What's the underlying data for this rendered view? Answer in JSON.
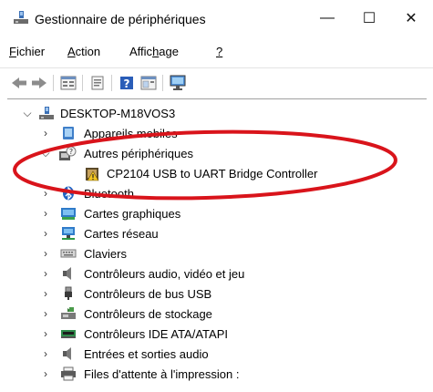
{
  "window": {
    "title": "Gestionnaire de périphériques",
    "minimize_symbol": "—",
    "maximize_symbol": "☐",
    "close_symbol": "✕"
  },
  "menu": [
    {
      "label": "Fichier",
      "access_key_index": 0
    },
    {
      "label": "Action",
      "access_key_index": 0
    },
    {
      "label": "Affichage",
      "access_key_index": 5
    },
    {
      "label": "?",
      "access_key_index": 0
    }
  ],
  "toolbar": {
    "buttons": [
      "back-icon",
      "forward-icon",
      "properties-icon",
      "view-icon",
      "help-icon",
      "update-icon",
      "monitor-icon"
    ]
  },
  "tree": {
    "root": {
      "label": "DESKTOP-M18VOS3",
      "icon": "computer-icon",
      "expanded": true
    },
    "items": [
      {
        "label": "Appareils mobiles",
        "icon": "mobile-device-icon",
        "expanded": false,
        "level": 1
      },
      {
        "label": "Autres périphériques",
        "icon": "unknown-device-icon",
        "expanded": true,
        "level": 1
      },
      {
        "label": "CP2104 USB to UART Bridge Controller",
        "icon": "warning-device-icon",
        "expanded": null,
        "level": 2
      },
      {
        "label": "Bluetooth",
        "icon": "bluetooth-icon",
        "expanded": false,
        "level": 1
      },
      {
        "label": "Cartes graphiques",
        "icon": "display-adapter-icon",
        "expanded": false,
        "level": 1
      },
      {
        "label": "Cartes réseau",
        "icon": "network-adapter-icon",
        "expanded": false,
        "level": 1
      },
      {
        "label": "Claviers",
        "icon": "keyboard-icon",
        "expanded": false,
        "level": 1
      },
      {
        "label": "Contrôleurs audio, vidéo et jeu",
        "icon": "audio-icon",
        "expanded": false,
        "level": 1
      },
      {
        "label": "Contrôleurs de bus USB",
        "icon": "usb-icon",
        "expanded": false,
        "level": 1
      },
      {
        "label": "Contrôleurs de stockage",
        "icon": "storage-icon",
        "expanded": false,
        "level": 1
      },
      {
        "label": "Contrôleurs IDE ATA/ATAPI",
        "icon": "ide-icon",
        "expanded": false,
        "level": 1
      },
      {
        "label": "Entrées et sorties audio",
        "icon": "audio-io-icon",
        "expanded": false,
        "level": 1
      },
      {
        "label": "Files d'attente à l'impression :",
        "icon": "print-queue-icon",
        "expanded": false,
        "level": 1
      }
    ]
  },
  "colors": {
    "highlight_ellipse": "#d9141b"
  }
}
